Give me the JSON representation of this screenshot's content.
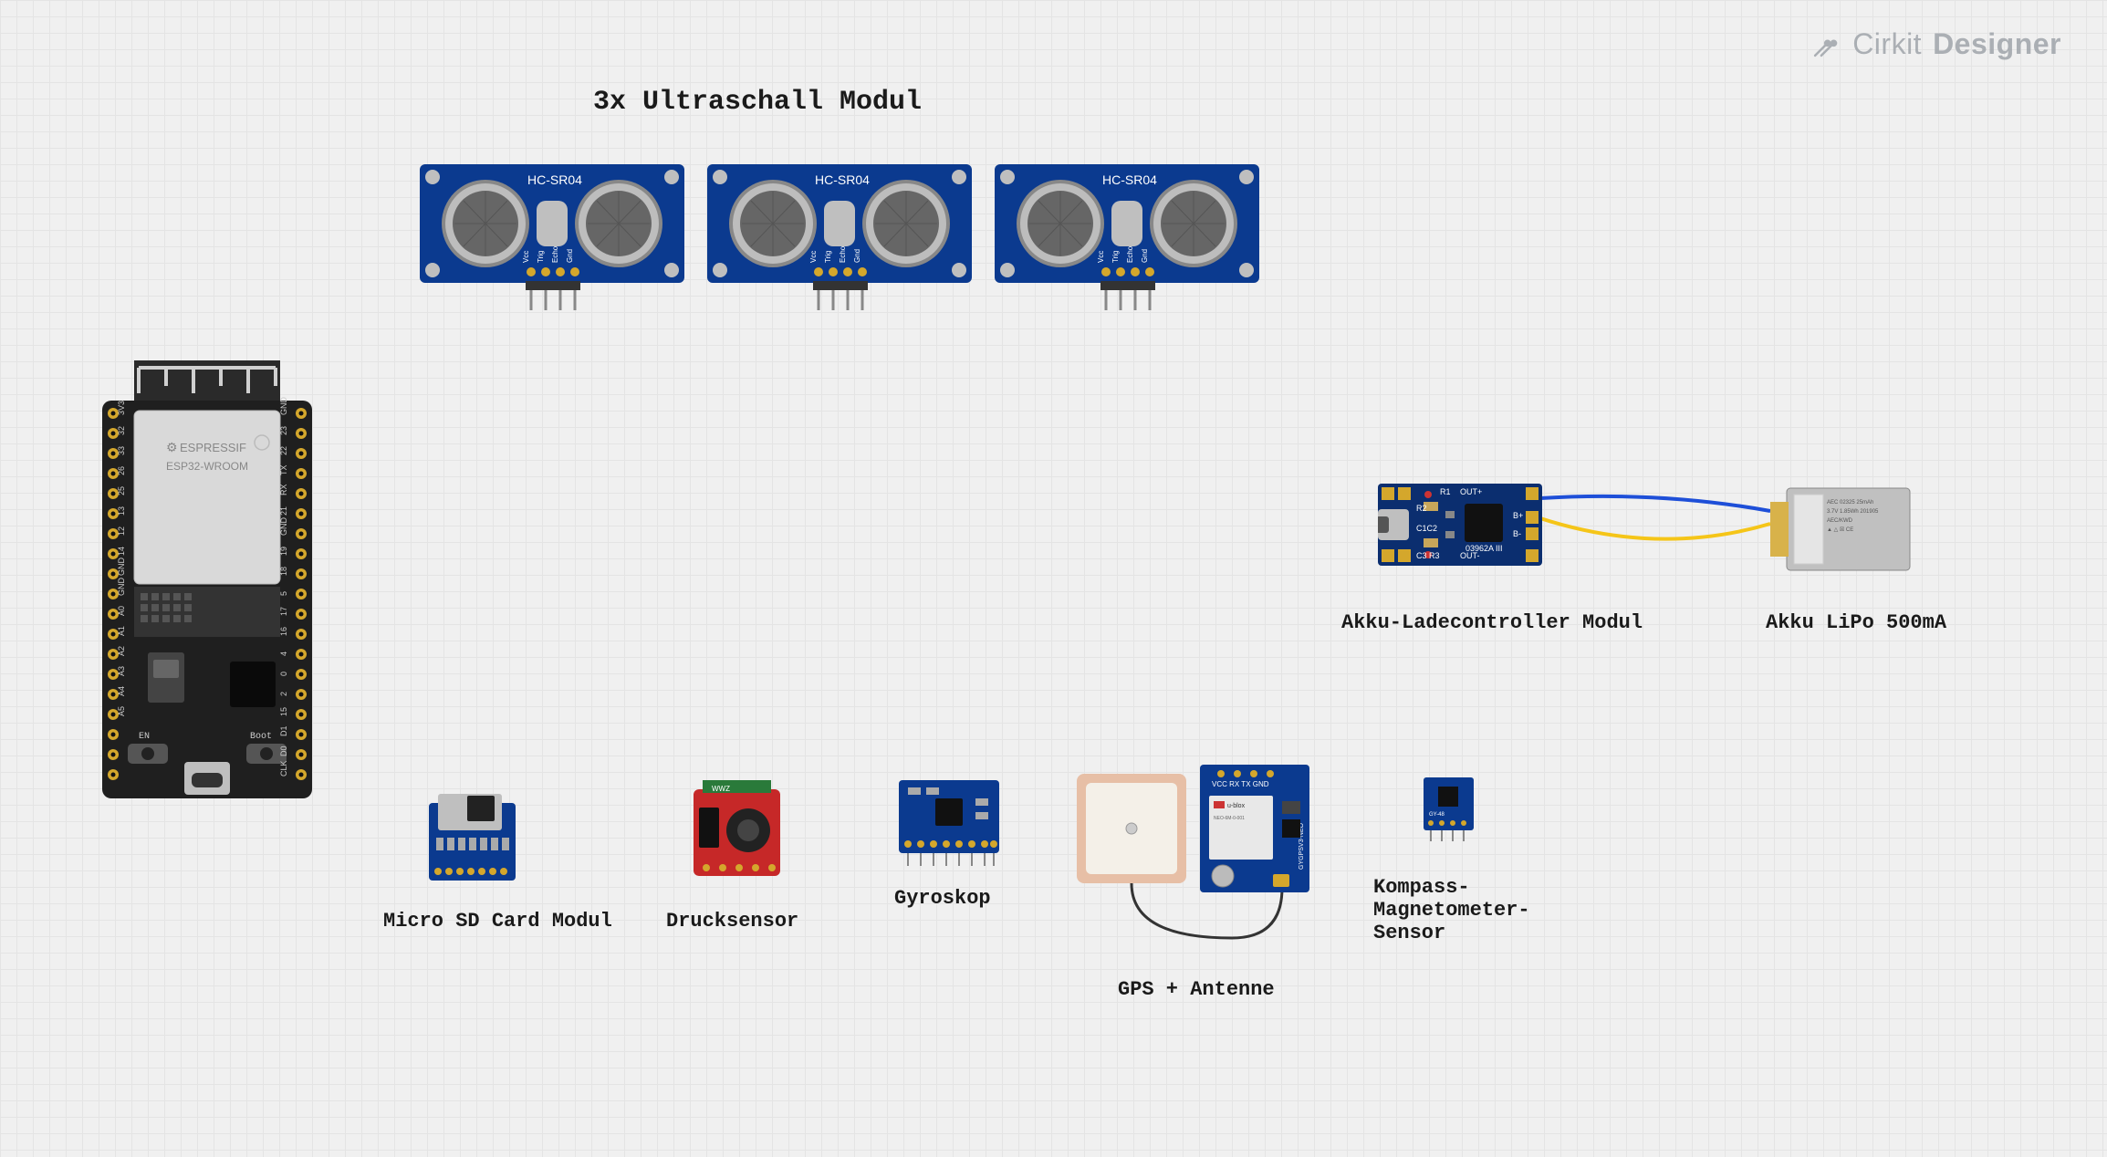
{
  "brand": {
    "name1": "Cirkit",
    "name2": "Designer"
  },
  "title_ultrasonic": "3x Ultraschall Modul",
  "labels": {
    "charger": "Akku-Ladecontroller Modul",
    "battery": "Akku LiPo 500mA",
    "sdcard": "Micro SD Card Modul",
    "pressure": "Drucksensor",
    "gyro": "Gyroskop",
    "gps": "GPS + Antenne",
    "compass": "Kompass-\nMagnetometer-\nSensor"
  },
  "board_text": {
    "esp_brand": "ESPRESSIF",
    "esp_chip": "ESP32-WROOM",
    "ultra_model": "HC-SR04",
    "ultra_pins": [
      "Vcc",
      "Trig",
      "Echo",
      "Gnd"
    ],
    "esp_en": "EN",
    "esp_boot": "Boot",
    "charger_out_plus": "OUT+",
    "charger_out_minus": "OUT-",
    "charger_b_plus": "B+",
    "charger_b_minus": "B-",
    "charger_c1c2": "C1C2",
    "charger_r1": "R1",
    "charger_r2": "R2",
    "charger_c3r3": "C3 R3",
    "charger_code": "03962A III",
    "gps_pins": "VCC RX TX GND",
    "gps_ublox": "u-blox",
    "compass_model": "GY-48",
    "esp_pins_left": [
      "A5",
      "A4",
      "A3",
      "A2",
      "A1",
      "A0",
      "GND",
      "GND",
      "14",
      "12",
      "13",
      "25",
      "26",
      "33",
      "32",
      "3V3"
    ],
    "esp_pins_right": [
      "CLK",
      "D0",
      "D1",
      "15",
      "2",
      "0",
      "4",
      "16",
      "17",
      "5",
      "18",
      "19",
      "GND",
      "21",
      "RX",
      "TX",
      "22",
      "23",
      "GND"
    ]
  }
}
